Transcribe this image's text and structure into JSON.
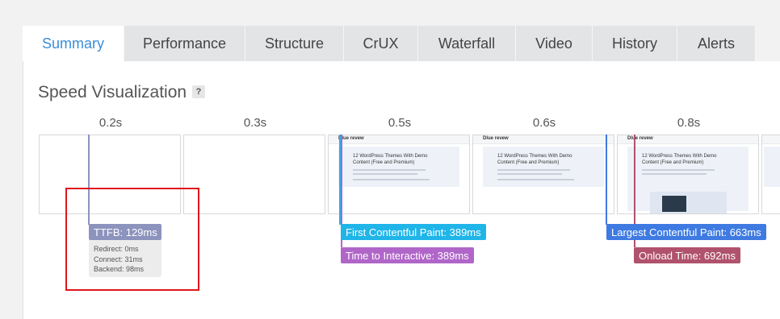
{
  "tabs": [
    {
      "label": "Summary",
      "active": true
    },
    {
      "label": "Performance",
      "active": false
    },
    {
      "label": "Structure",
      "active": false
    },
    {
      "label": "CrUX",
      "active": false
    },
    {
      "label": "Waterfall",
      "active": false
    },
    {
      "label": "Video",
      "active": false
    },
    {
      "label": "History",
      "active": false
    },
    {
      "label": "Alerts",
      "active": false
    }
  ],
  "section": {
    "title": "Speed Visualization",
    "help_glyph": "?"
  },
  "timeline": {
    "labels": [
      "0.2s",
      "0.3s",
      "0.5s",
      "0.6s",
      "0.8s"
    ]
  },
  "thumbnail": {
    "logo": "Dlue revew",
    "heading": "12 WordPress Themes With Demo Content (Free and Premium)"
  },
  "markers": {
    "ttfb": {
      "label": "TTFB: 129ms",
      "color": "#8c93bd"
    },
    "ttfb_details": {
      "redirect": "Redirect: 0ms",
      "connect": "Connect: 31ms",
      "backend": "Backend: 98ms"
    },
    "fcp": {
      "label": "First Contentful Paint: 389ms",
      "color": "#1fb5e9"
    },
    "tti": {
      "label": "Time to Interactive: 389ms",
      "color": "#b066c8"
    },
    "lcp": {
      "label": "Largest Contentful Paint: 663ms",
      "color": "#3e7ae2"
    },
    "onload": {
      "label": "Onload Time: 692ms",
      "color": "#b0526e"
    }
  }
}
